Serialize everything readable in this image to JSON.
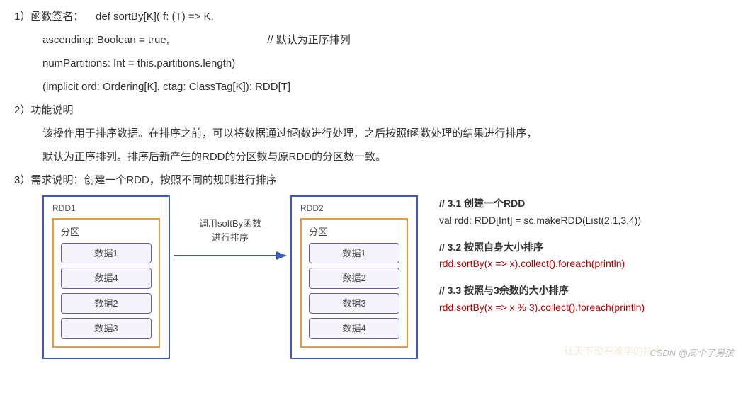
{
  "section1": {
    "prefix": "1）函数签名：",
    "sig_line1": "def sortBy[K]( f: (T) => K,",
    "sig_line2_a": "ascending: Boolean = true,",
    "sig_line2_b": "// 默认为正序排列",
    "sig_line3": "numPartitions: Int = this.partitions.length)",
    "sig_line4": "(implicit ord: Ordering[K], ctag: ClassTag[K]): RDD[T]"
  },
  "section2": {
    "prefix": "2）功能说明",
    "body1": "该操作用于排序数据。在排序之前，可以将数据通过f函数进行处理，之后按照f函数处理的结果进行排序，",
    "body2": "默认为正序排列。排序后新产生的RDD的分区数与原RDD的分区数一致。"
  },
  "section3": {
    "prefix": "3）需求说明：创建一个RDD，按照不同的规则进行排序"
  },
  "diagram": {
    "rdd1": {
      "label": "RDD1",
      "partition": "分区",
      "items": [
        "数据1",
        "数据4",
        "数据2",
        "数据3"
      ]
    },
    "arrow_caption1": "调用softBy函数",
    "arrow_caption2": "进行排序",
    "rdd2": {
      "label": "RDD2",
      "partition": "分区",
      "items": [
        "数据1",
        "数据2",
        "数据3",
        "数据4"
      ]
    }
  },
  "code": {
    "c31_comment": "// 3.1 创建一个RDD",
    "c31_code": "val rdd: RDD[Int] = sc.makeRDD(List(2,1,3,4))",
    "c32_comment": "// 3.2 按照自身大小排序",
    "c32_code": "rdd.sortBy(x => x).collect().foreach(println)",
    "c33_comment": "// 3.3 按照与3余数的大小排序",
    "c33_code": "rdd.sortBy(x => x % 3).collect().foreach(println)"
  },
  "watermark2": "让天下没有难学的技术",
  "watermark": "CSDN @高个子男孩"
}
